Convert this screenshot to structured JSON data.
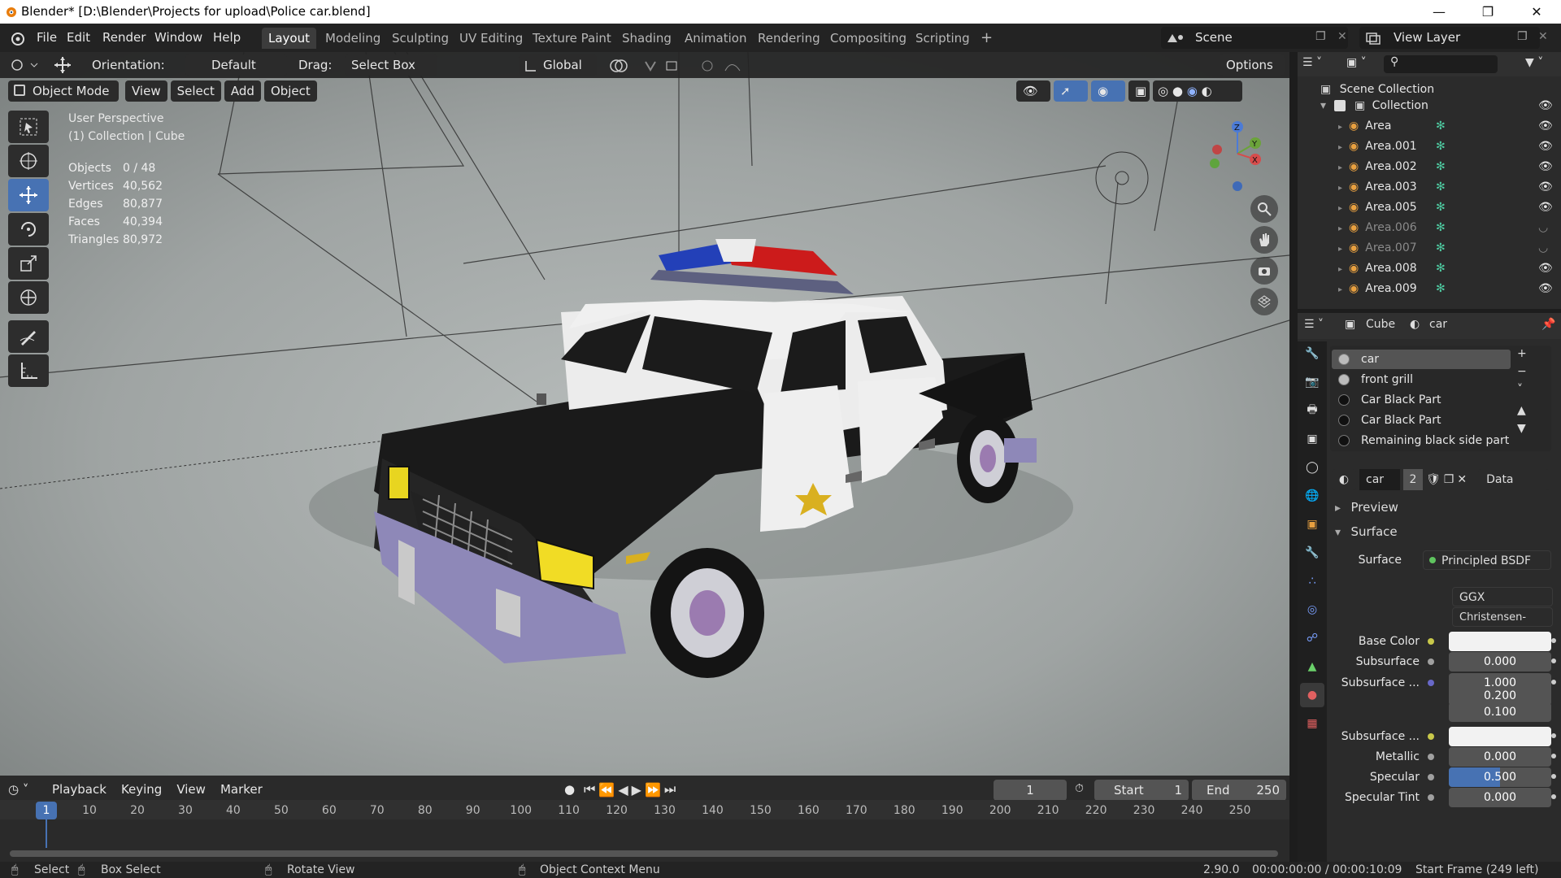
{
  "title": "Blender* [D:\\Blender\\Projects for upload\\Police car.blend]",
  "menu": [
    "File",
    "Edit",
    "Render",
    "Window",
    "Help"
  ],
  "workspaces": [
    "Layout",
    "Modeling",
    "Sculpting",
    "UV Editing",
    "Texture Paint",
    "Shading",
    "Animation",
    "Rendering",
    "Compositing",
    "Scripting"
  ],
  "active_workspace": "Layout",
  "scene": "Scene",
  "view_layer": "View Layer",
  "toolheader": {
    "orientation_label": "Orientation:",
    "orientation_value": "Default",
    "drag_label": "Drag:",
    "drag_value": "Select Box",
    "transform_orientation": "Global",
    "options": "Options"
  },
  "viewport_header": {
    "mode": "Object Mode",
    "menus": [
      "View",
      "Select",
      "Add",
      "Object"
    ]
  },
  "overlay": {
    "perspective": "User Perspective",
    "collection": "(1) Collection | Cube",
    "stats": [
      {
        "label": "Objects",
        "value": "0 / 48"
      },
      {
        "label": "Vertices",
        "value": "40,562"
      },
      {
        "label": "Edges",
        "value": "80,877"
      },
      {
        "label": "Faces",
        "value": "40,394"
      },
      {
        "label": "Triangles",
        "value": "80,972"
      }
    ]
  },
  "gizmo": {
    "z": "Z",
    "y": "Y",
    "x": "X"
  },
  "outliner": {
    "root": "Scene Collection",
    "collection": "Collection",
    "items": [
      {
        "name": "Area",
        "visible": true
      },
      {
        "name": "Area.001",
        "visible": true
      },
      {
        "name": "Area.002",
        "visible": true
      },
      {
        "name": "Area.003",
        "visible": true
      },
      {
        "name": "Area.005",
        "visible": true
      },
      {
        "name": "Area.006",
        "visible": false
      },
      {
        "name": "Area.007",
        "visible": false
      },
      {
        "name": "Area.008",
        "visible": true
      },
      {
        "name": "Area.009",
        "visible": true
      }
    ]
  },
  "properties": {
    "object": "Cube",
    "material": "car",
    "slots": [
      "car",
      "front grill",
      "Car Black Part",
      "Car Black Part",
      "Remaining black side part"
    ],
    "material_name": "car",
    "users": "2",
    "link": "Data",
    "panels": {
      "preview": "Preview",
      "surface": "Surface"
    },
    "surface_label": "Surface",
    "surface_value": "Principled BSDF",
    "distribution": "GGX",
    "subsurface_method": "Christensen-Burley",
    "rows": [
      {
        "label": "Base Color",
        "type": "color",
        "dot": "#c8c84a"
      },
      {
        "label": "Subsurface",
        "value": "0.000",
        "dot": "#a0a0a0"
      },
      {
        "label": "Subsurface ...",
        "value": "1.000",
        "dot": "#6868c8"
      },
      {
        "label": "",
        "value": "0.200"
      },
      {
        "label": "",
        "value": "0.100"
      },
      {
        "label": "Subsurface ...",
        "type": "color",
        "dot": "#c8c84a"
      },
      {
        "label": "Metallic",
        "value": "0.000",
        "dot": "#a0a0a0"
      },
      {
        "label": "Specular",
        "value": "0.500",
        "dot": "#a0a0a0",
        "fill": 0.5
      },
      {
        "label": "Specular Tint",
        "value": "0.000",
        "dot": "#a0a0a0"
      }
    ]
  },
  "timeline": {
    "menus": [
      "Playback",
      "Keying",
      "View",
      "Marker"
    ],
    "current_frame": "1",
    "start_label": "Start",
    "start": "1",
    "end_label": "End",
    "end": "250",
    "ticks": [
      "1",
      "10",
      "20",
      "30",
      "40",
      "50",
      "60",
      "70",
      "80",
      "90",
      "100",
      "110",
      "120",
      "130",
      "140",
      "150",
      "160",
      "170",
      "180",
      "190",
      "200",
      "210",
      "220",
      "230",
      "240",
      "250"
    ]
  },
  "status": {
    "select": "Select",
    "box_select": "Box Select",
    "rotate": "Rotate View",
    "context": "Object Context Menu",
    "version": "2.90.0",
    "time": "00:00:00:00 / 00:00:10:09",
    "frames": "Start Frame (249 left)"
  },
  "colors": {
    "accent": "#4772b3",
    "viewport": "#3d3d3d",
    "panel": "#2b2b2b"
  }
}
